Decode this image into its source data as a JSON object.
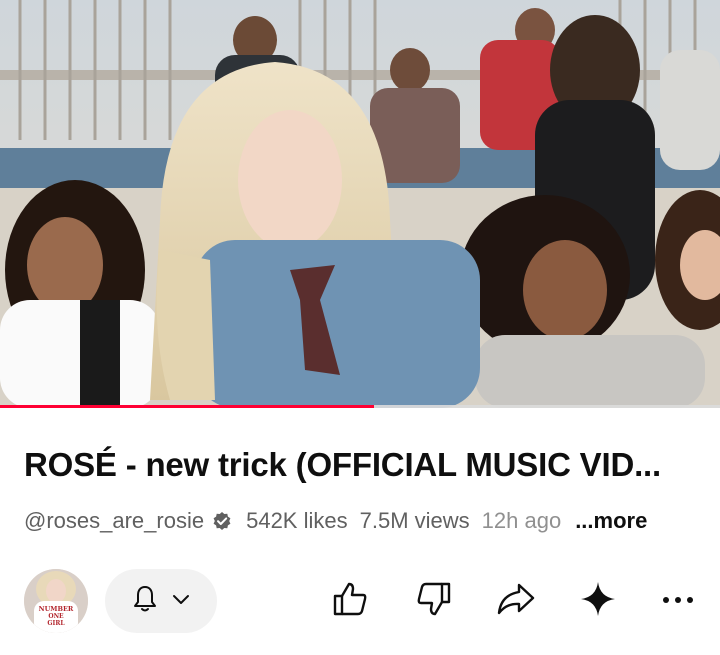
{
  "video": {
    "progress_fraction": 0.52
  },
  "title": "ROSÉ - new trick (OFFICIAL MUSIC VID...",
  "meta": {
    "channel": "@roses_are_rosie",
    "likes": "542K likes",
    "views": "7.5M views",
    "ago": "12h ago",
    "more": "...more"
  },
  "avatar": {
    "shirt_text": [
      "NUMBER",
      "ONE",
      "GIRL"
    ]
  },
  "actions": {
    "icons": [
      "bell-icon",
      "chevron-down-icon",
      "like-icon",
      "dislike-icon",
      "share-icon",
      "sparkle-icon",
      "more-icon"
    ]
  },
  "colors": {
    "progress": "#ff0033",
    "text_primary": "#0f0f0f",
    "text_secondary": "#606060",
    "pill_bg": "#f2f2f2"
  }
}
